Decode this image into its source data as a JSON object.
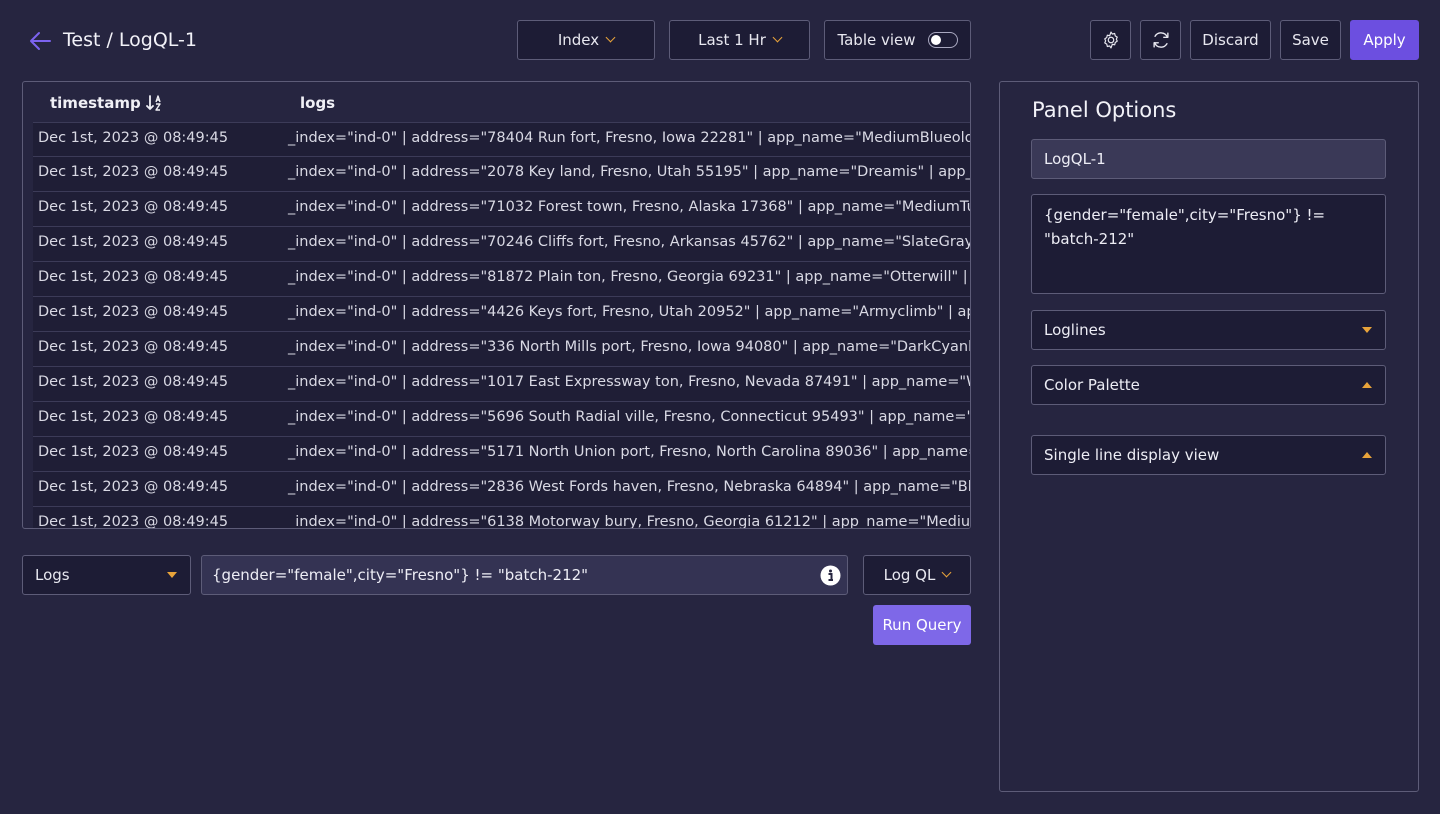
{
  "header": {
    "title": "Test / LogQL-1",
    "index_label": "Index",
    "time_label": "Last 1 Hr",
    "table_view_label": "Table view",
    "table_view_on": false,
    "discard_label": "Discard",
    "save_label": "Save",
    "apply_label": "Apply"
  },
  "table": {
    "columns": [
      "timestamp",
      "logs"
    ],
    "rows": [
      {
        "timestamp": "Dec 1st, 2023 @ 08:49:45",
        "log": "_index=\"ind-0\" | address=\"78404 Run fort, Fresno, Iowa 22281\" | app_name=\"MediumBlueold Age"
      },
      {
        "timestamp": "Dec 1st, 2023 @ 08:49:45",
        "log": "_index=\"ind-0\" | address=\"2078 Key land, Fresno, Utah 55195\" | app_name=\"Dreamis\" | app_vers"
      },
      {
        "timestamp": "Dec 1st, 2023 @ 08:49:45",
        "log": "_index=\"ind-0\" | address=\"71032 Forest town, Fresno, Alaska 17368\" | app_name=\"MediumTurqu"
      },
      {
        "timestamp": "Dec 1st, 2023 @ 08:49:45",
        "log": "_index=\"ind-0\" | address=\"70246 Cliffs fort, Fresno, Arkansas 45762\" | app_name=\"SlateGrayholi"
      },
      {
        "timestamp": "Dec 1st, 2023 @ 08:49:45",
        "log": "_index=\"ind-0\" | address=\"81872 Plain ton, Fresno, Georgia 69231\" | app_name=\"Otterwill\" | app_"
      },
      {
        "timestamp": "Dec 1st, 2023 @ 08:49:45",
        "log": "_index=\"ind-0\" | address=\"4426 Keys fort, Fresno, Utah 20952\" | app_name=\"Armyclimb\" | app_ve"
      },
      {
        "timestamp": "Dec 1st, 2023 @ 08:49:45",
        "log": "_index=\"ind-0\" | address=\"336 North Mills port, Fresno, Iowa 94080\" | app_name=\"DarkCyanbody"
      },
      {
        "timestamp": "Dec 1st, 2023 @ 08:49:45",
        "log": "_index=\"ind-0\" | address=\"1017 East Expressway ton, Fresno, Nevada 87491\" | app_name=\"Wood"
      },
      {
        "timestamp": "Dec 1st, 2023 @ 08:49:45",
        "log": "_index=\"ind-0\" | address=\"5696 South Radial ville, Fresno, Connecticut 95493\" | app_name=\"Nes"
      },
      {
        "timestamp": "Dec 1st, 2023 @ 08:49:45",
        "log": "_index=\"ind-0\" | address=\"5171 North Union port, Fresno, North Carolina 89036\" | app_name=\"M"
      },
      {
        "timestamp": "Dec 1st, 2023 @ 08:49:45",
        "log": "_index=\"ind-0\" | address=\"2836 West Fords haven, Fresno, Nebraska 64894\" | app_name=\"Blanc"
      },
      {
        "timestamp": "Dec 1st, 2023 @ 08:49:45",
        "log": "_index=\"ind-0\" | address=\"6138 Motorway bury, Fresno, Georgia 61212\" | app_name=\"MediumPu"
      }
    ]
  },
  "query": {
    "source_label": "Logs",
    "value": "{gender=\"female\",city=\"Fresno\"} != \"batch-212\"",
    "language_label": "Log QL",
    "run_label": "Run Query"
  },
  "options": {
    "title": "Panel Options",
    "panel_name": "LogQL-1",
    "expression": "{gender=\"female\",city=\"Fresno\"} != \"batch-212\"",
    "visualization_label": "Loglines",
    "color_palette_label": "Color Palette",
    "display_view_label": "Single line display view"
  },
  "colors": {
    "background": "#262540",
    "accent": "#6c4fe0",
    "run_button": "#7e68e8",
    "caret": "#e8a33a"
  },
  "icons": {
    "back": "arrow-left-icon",
    "settings": "gear-icon",
    "refresh": "refresh-icon",
    "sort": "sort-icon",
    "info": "info-icon"
  }
}
